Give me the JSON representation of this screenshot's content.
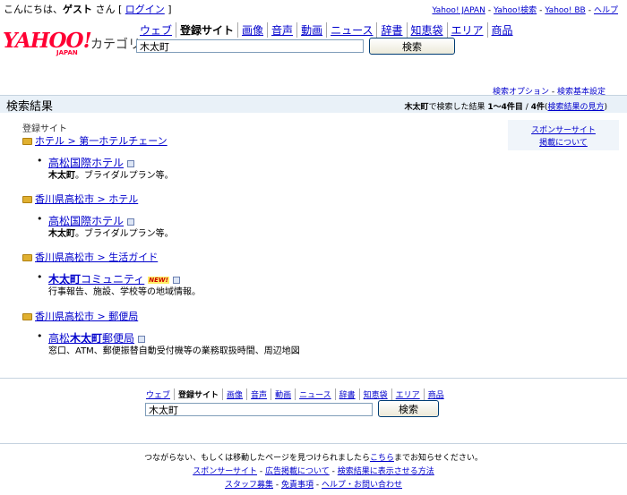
{
  "header": {
    "greeting_prefix": "こんにちは、",
    "guest": "ゲスト",
    "greeting_suffix": " さん [ ",
    "login": "ログイン",
    "greeting_end": " ]",
    "links": [
      "Yahoo! JAPAN",
      "Yahoo!検索",
      "Yahoo! BB",
      "ヘルプ"
    ],
    "link_separator": "-"
  },
  "logo": {
    "text": "YAHOO!",
    "sub": "JAPAN",
    "category_label": "カテゴリ"
  },
  "search_tabs": [
    "ウェブ",
    "登録サイト",
    "画像",
    "音声",
    "動画",
    "ニュース",
    "辞書",
    "知恵袋",
    "エリア",
    "商品"
  ],
  "active_tab": "登録サイト",
  "search": {
    "query": "木太町",
    "button": "検索"
  },
  "options": {
    "search_option": "検索オプション",
    "separator": "-",
    "search_settings": "検索基本設定"
  },
  "results_header": {
    "title": "検索結果",
    "query_bold": "木太町",
    "info_mid": "で検索した結果 ",
    "range": "1〜4件目",
    "total_mid": " / ",
    "total": "4件",
    "guide_open": "(",
    "guide": "検索結果の見方",
    "guide_close": ")"
  },
  "section_label": "登録サイト",
  "sponsor": {
    "sponsor_site": "スポンサーサイト",
    "listing": "掲載について"
  },
  "groups": [
    {
      "category": "ホテル > 第一ホテルチェーン",
      "title_parts": [
        "",
        "",
        "高松国際ホテル"
      ],
      "new": false,
      "desc_bold": "木太町",
      "desc": "。ブライダルプラン等。"
    },
    {
      "category": "香川県高松市 > ホテル",
      "title_parts": [
        "",
        "",
        "高松国際ホテル"
      ],
      "new": false,
      "desc_bold": "木太町",
      "desc": "。ブライダルプラン等。"
    },
    {
      "category": "香川県高松市 > 生活ガイド",
      "title_parts": [
        "",
        "木太町",
        "コミュニティ"
      ],
      "new": true,
      "new_label": "NEW!",
      "desc_bold": "",
      "desc": "行事報告、施設、学校等の地域情報。"
    },
    {
      "category": "香川県高松市 > 郵便局",
      "title_parts": [
        "高松",
        "木太町",
        "郵便局"
      ],
      "new": false,
      "desc_bold": "",
      "desc": "窓口、ATM、郵便振替自動受付機等の業務取扱時間、周辺地図"
    }
  ],
  "footer": {
    "line1_pre": "つながらない、もしくは移動したページを見つけられましたら",
    "line1_link": "こちら",
    "line1_post": "までお知らせください。",
    "line2": [
      "スポンサーサイト",
      "広告掲載について",
      "検索結果に表示させる方法"
    ],
    "line3": [
      "スタッフ募集",
      "免責事項",
      "ヘルプ・お問い合わせ"
    ],
    "separator": "-"
  },
  "colors": {
    "link": "#0000cc",
    "header_bar": "#e9f1f8",
    "logo_red": "#ff0033",
    "folder": "#e0b030"
  }
}
